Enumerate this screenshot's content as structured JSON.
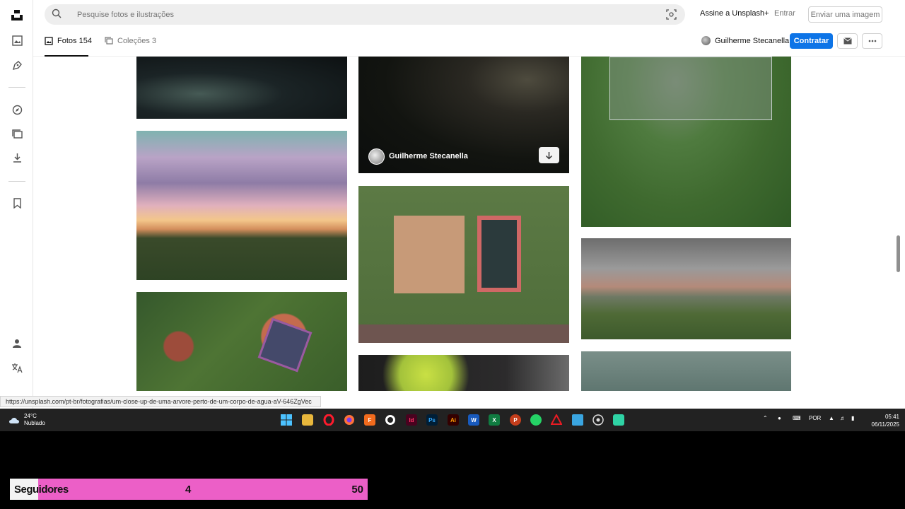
{
  "search": {
    "placeholder": "Pesquise fotos e ilustrações"
  },
  "header": {
    "subscribe": "Assine a Unsplash+",
    "login": "Entrar",
    "upload": "Enviar uma imagem"
  },
  "tabs": [
    {
      "label": "Fotos",
      "count": "154"
    },
    {
      "label": "Coleções",
      "count": "3"
    }
  ],
  "profile": {
    "name": "Guilherme Stecanella",
    "hire": "Contratar"
  },
  "photo_hover": {
    "author": "Guilherme Stecanella"
  },
  "status_url": "https://unsplash.com/pt-br/fotografias/um-close-up-de-uma-arvore-perto-de-um-corpo-de-agua-aV-646ZgVec",
  "taskbar": {
    "weather_temp": "24°C",
    "weather_desc": "Nublado",
    "language": "POR",
    "time": "05:41",
    "date": "06/11/2025"
  },
  "followers": {
    "label": "Seguidores",
    "count": "4",
    "goal": "50"
  },
  "colors": {
    "accent": "#0d74e7",
    "overlay": "#ec5fc7"
  }
}
